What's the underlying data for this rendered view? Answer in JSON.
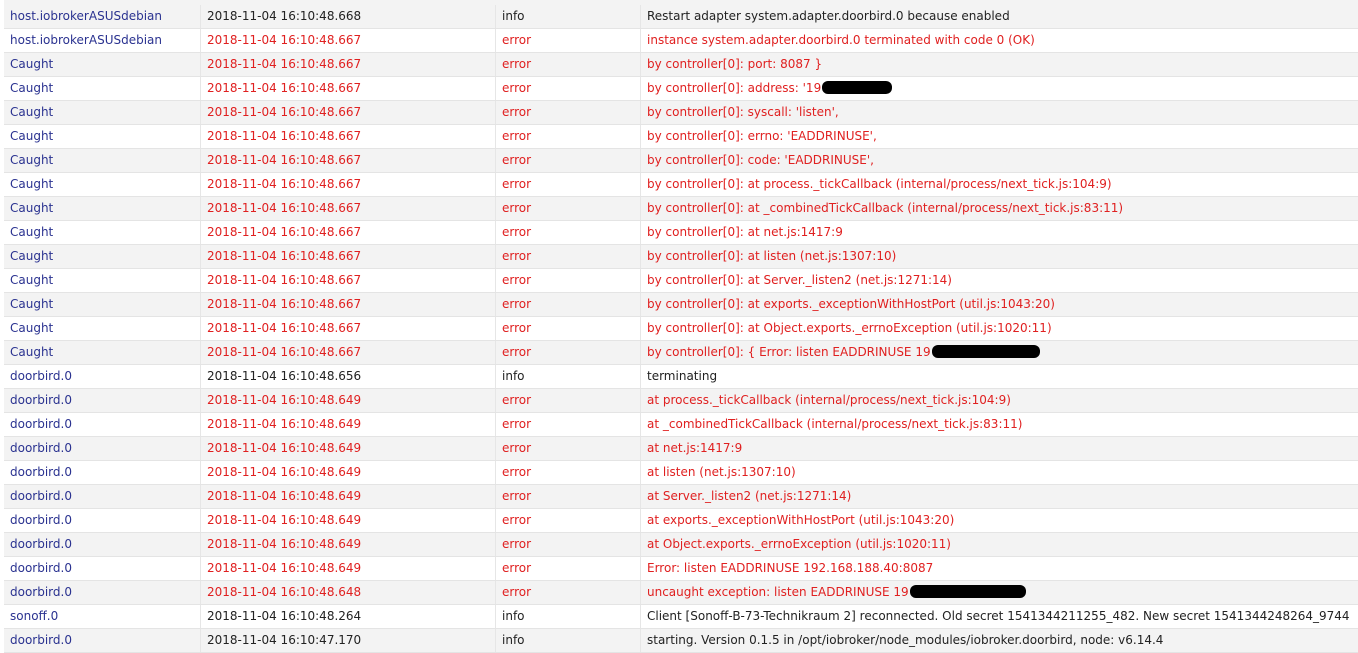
{
  "colors": {
    "source": "#2a3290",
    "error": "#e02020",
    "info": "#222222"
  },
  "rows": [
    {
      "source": "host.iobrokerASUSdebian",
      "time": "2018-11-04 16:10:48.668",
      "severity": "info",
      "message": "Restart adapter system.adapter.doorbird.0 because enabled"
    },
    {
      "source": "host.iobrokerASUSdebian",
      "time": "2018-11-04 16:10:48.667",
      "severity": "error",
      "message": "instance system.adapter.doorbird.0 terminated with code 0 (OK)"
    },
    {
      "source": "Caught",
      "time": "2018-11-04 16:10:48.667",
      "severity": "error",
      "message": "by controller[0]: port: 8087 }"
    },
    {
      "source": "Caught",
      "time": "2018-11-04 16:10:48.667",
      "severity": "error",
      "message": "by controller[0]: address: '19",
      "redacted": true
    },
    {
      "source": "Caught",
      "time": "2018-11-04 16:10:48.667",
      "severity": "error",
      "message": "by controller[0]: syscall: 'listen',"
    },
    {
      "source": "Caught",
      "time": "2018-11-04 16:10:48.667",
      "severity": "error",
      "message": "by controller[0]: errno: 'EADDRINUSE',"
    },
    {
      "source": "Caught",
      "time": "2018-11-04 16:10:48.667",
      "severity": "error",
      "message": "by controller[0]: code: 'EADDRINUSE',"
    },
    {
      "source": "Caught",
      "time": "2018-11-04 16:10:48.667",
      "severity": "error",
      "message": "by controller[0]: at process._tickCallback (internal/process/next_tick.js:104:9)"
    },
    {
      "source": "Caught",
      "time": "2018-11-04 16:10:48.667",
      "severity": "error",
      "message": "by controller[0]: at _combinedTickCallback (internal/process/next_tick.js:83:11)"
    },
    {
      "source": "Caught",
      "time": "2018-11-04 16:10:48.667",
      "severity": "error",
      "message": "by controller[0]: at net.js:1417:9"
    },
    {
      "source": "Caught",
      "time": "2018-11-04 16:10:48.667",
      "severity": "error",
      "message": "by controller[0]: at listen (net.js:1307:10)"
    },
    {
      "source": "Caught",
      "time": "2018-11-04 16:10:48.667",
      "severity": "error",
      "message": "by controller[0]: at Server._listen2 (net.js:1271:14)"
    },
    {
      "source": "Caught",
      "time": "2018-11-04 16:10:48.667",
      "severity": "error",
      "message": "by controller[0]: at exports._exceptionWithHostPort (util.js:1043:20)"
    },
    {
      "source": "Caught",
      "time": "2018-11-04 16:10:48.667",
      "severity": "error",
      "message": "by controller[0]: at Object.exports._errnoException (util.js:1020:11)"
    },
    {
      "source": "Caught",
      "time": "2018-11-04 16:10:48.667",
      "severity": "error",
      "message": "by controller[0]: { Error: listen EADDRINUSE 19",
      "redacted": true
    },
    {
      "source": "doorbird.0",
      "time": "2018-11-04 16:10:48.656",
      "severity": "info",
      "message": "terminating"
    },
    {
      "source": "doorbird.0",
      "time": "2018-11-04 16:10:48.649",
      "severity": "error",
      "message": "at process._tickCallback (internal/process/next_tick.js:104:9)"
    },
    {
      "source": "doorbird.0",
      "time": "2018-11-04 16:10:48.649",
      "severity": "error",
      "message": "at _combinedTickCallback (internal/process/next_tick.js:83:11)"
    },
    {
      "source": "doorbird.0",
      "time": "2018-11-04 16:10:48.649",
      "severity": "error",
      "message": "at net.js:1417:9"
    },
    {
      "source": "doorbird.0",
      "time": "2018-11-04 16:10:48.649",
      "severity": "error",
      "message": "at listen (net.js:1307:10)"
    },
    {
      "source": "doorbird.0",
      "time": "2018-11-04 16:10:48.649",
      "severity": "error",
      "message": "at Server._listen2 (net.js:1271:14)"
    },
    {
      "source": "doorbird.0",
      "time": "2018-11-04 16:10:48.649",
      "severity": "error",
      "message": "at exports._exceptionWithHostPort (util.js:1043:20)"
    },
    {
      "source": "doorbird.0",
      "time": "2018-11-04 16:10:48.649",
      "severity": "error",
      "message": "at Object.exports._errnoException (util.js:1020:11)"
    },
    {
      "source": "doorbird.0",
      "time": "2018-11-04 16:10:48.649",
      "severity": "error",
      "message": "Error: listen EADDRINUSE 192.168.188.40:8087"
    },
    {
      "source": "doorbird.0",
      "time": "2018-11-04 16:10:48.648",
      "severity": "error",
      "message": "uncaught exception: listen EADDRINUSE 19",
      "redacted": true
    },
    {
      "source": "sonoff.0",
      "time": "2018-11-04 16:10:48.264",
      "severity": "info",
      "message": "Client [Sonoff-B-73-Technikraum 2] reconnected. Old secret 1541344211255_482. New secret 1541344248264_9744"
    },
    {
      "source": "doorbird.0",
      "time": "2018-11-04 16:10:47.170",
      "severity": "info",
      "message": "starting. Version 0.1.5 in /opt/iobroker/node_modules/iobroker.doorbird, node: v6.14.4"
    }
  ]
}
